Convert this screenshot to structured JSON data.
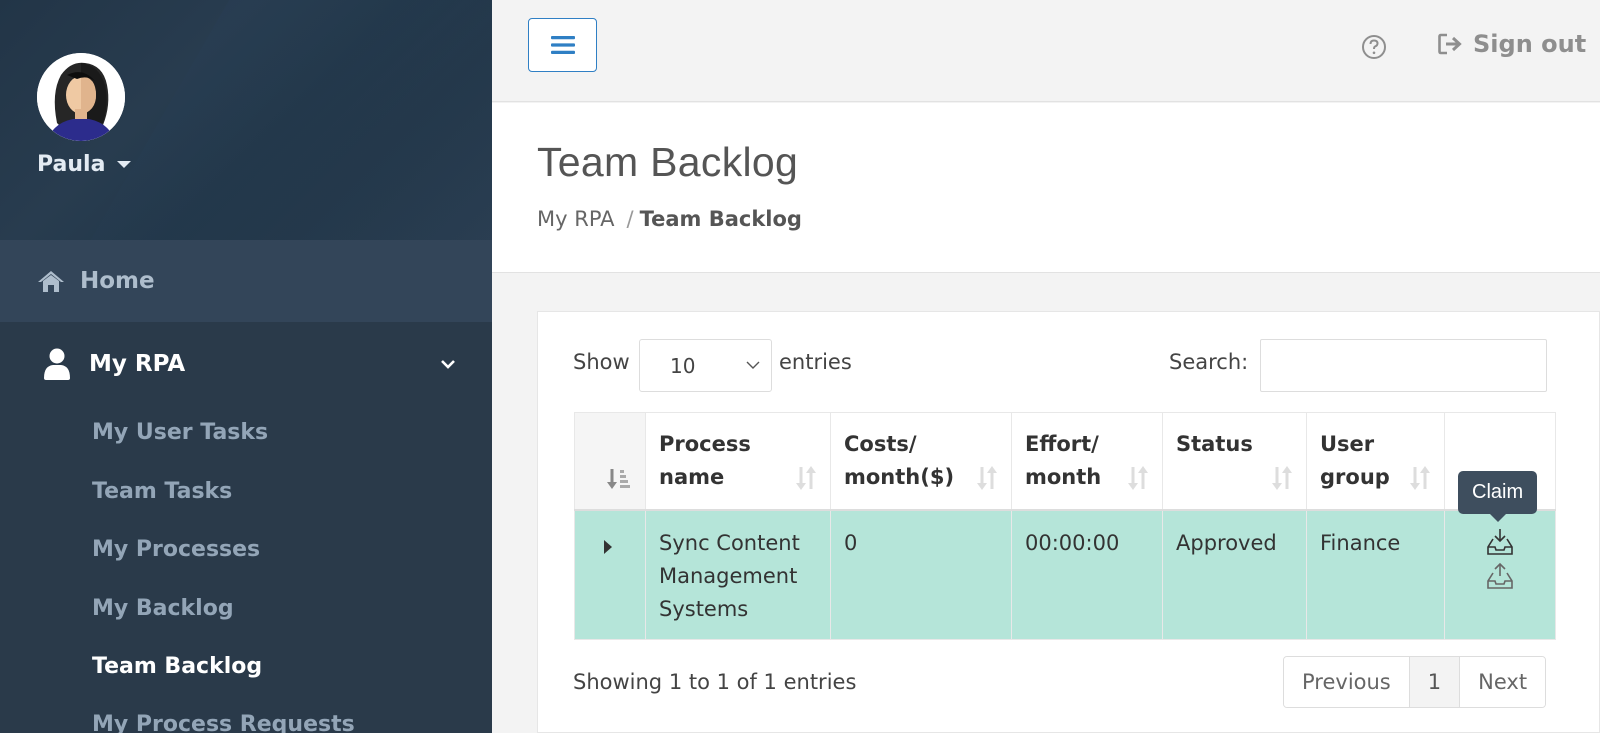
{
  "user": {
    "name": "Paula"
  },
  "sidebar": {
    "home": {
      "label": "Home",
      "icon": "home-icon"
    },
    "group": {
      "label": "My RPA",
      "icon": "user-icon",
      "expanded": true
    },
    "items": [
      {
        "label": "My User Tasks",
        "active": false
      },
      {
        "label": "Team Tasks",
        "active": false
      },
      {
        "label": "My Processes",
        "active": false
      },
      {
        "label": "My Backlog",
        "active": false
      },
      {
        "label": "Team Backlog",
        "active": true
      },
      {
        "label": "My Process Requests",
        "active": false
      }
    ]
  },
  "topbar": {
    "menu_icon": "hamburger-icon",
    "help_icon": "question-circle-icon",
    "signout_label": "Sign out",
    "signout_icon": "sign-out-icon"
  },
  "page": {
    "title": "Team Backlog",
    "breadcrumb": {
      "parent": "My RPA",
      "separator": "/",
      "current": "Team Backlog"
    }
  },
  "table_controls": {
    "show_label": "Show",
    "page_length": "10",
    "entries_label": "entries",
    "search_label": "Search:",
    "search_value": "",
    "search_placeholder": ""
  },
  "table": {
    "columns": [
      {
        "key": "ctrl",
        "label": ""
      },
      {
        "key": "process_name",
        "label": "Process name"
      },
      {
        "key": "costs",
        "label": "Costs/ month($)"
      },
      {
        "key": "effort",
        "label": "Effort/ month"
      },
      {
        "key": "status",
        "label": "Status"
      },
      {
        "key": "user_group",
        "label": "User group"
      },
      {
        "key": "actions",
        "label": ""
      }
    ],
    "rows": [
      {
        "process_name": "Sync Content Management Systems",
        "costs": "0",
        "effort": "00:00:00",
        "status": "Approved",
        "user_group": "Finance",
        "actions": [
          {
            "name": "claim",
            "icon": "inbox-download-icon",
            "tooltip": "Claim"
          },
          {
            "name": "release",
            "icon": "inbox-upload-icon"
          }
        ]
      }
    ]
  },
  "footer": {
    "info": "Showing 1 to 1 of 1 entries",
    "pagination": {
      "previous": "Previous",
      "current_page": "1",
      "next": "Next"
    }
  },
  "colors": {
    "sidebar_bg": "#2a3a4a",
    "row_highlight": "#b5e5d9",
    "accent": "#2f7fc4",
    "tooltip_bg": "#3e4e5e"
  }
}
